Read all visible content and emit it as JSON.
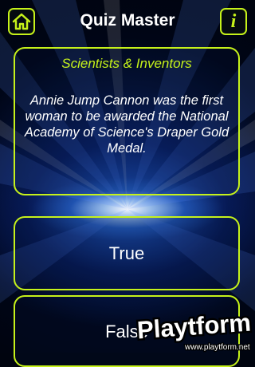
{
  "header": {
    "title": "Quiz Master",
    "home_icon": "home-icon",
    "info_icon": "info-icon",
    "info_glyph": "i"
  },
  "question": {
    "category": "Scientists & Inventors",
    "text": "Annie Jump Cannon was the first woman to be awarded the National Academy of Science's Draper Gold Medal."
  },
  "answers": [
    {
      "label": "True"
    },
    {
      "label": "False"
    }
  ],
  "watermark": {
    "logo_text": "Playtform",
    "url": "www.playtform.net"
  },
  "colors": {
    "accent": "#c6f21a",
    "background": "#00040f",
    "text": "#ffffff"
  }
}
